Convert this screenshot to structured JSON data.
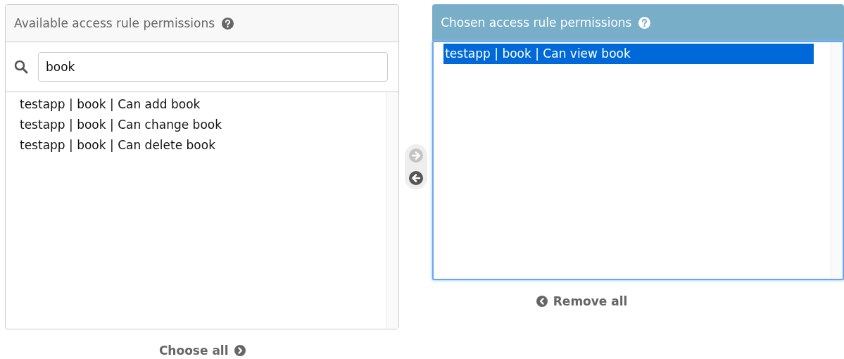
{
  "available": {
    "title": "Available access rule permissions",
    "search": {
      "value": "book"
    },
    "options": [
      {
        "label": "testapp | book | Can add book",
        "selected": false
      },
      {
        "label": "testapp | book | Can change book",
        "selected": false
      },
      {
        "label": "testapp | book | Can delete book",
        "selected": false
      }
    ],
    "choose_all": {
      "label": "Choose all",
      "disabled": false
    }
  },
  "move_buttons": [
    {
      "kind": "add",
      "disabled": true
    },
    {
      "kind": "remove",
      "disabled": false
    }
  ],
  "chosen": {
    "title": "Chosen access rule permissions",
    "focused": true,
    "options": [
      {
        "label": "testapp | book | Can view book",
        "selected": true
      }
    ],
    "remove_all": {
      "label": "Remove all",
      "disabled": false
    }
  }
}
